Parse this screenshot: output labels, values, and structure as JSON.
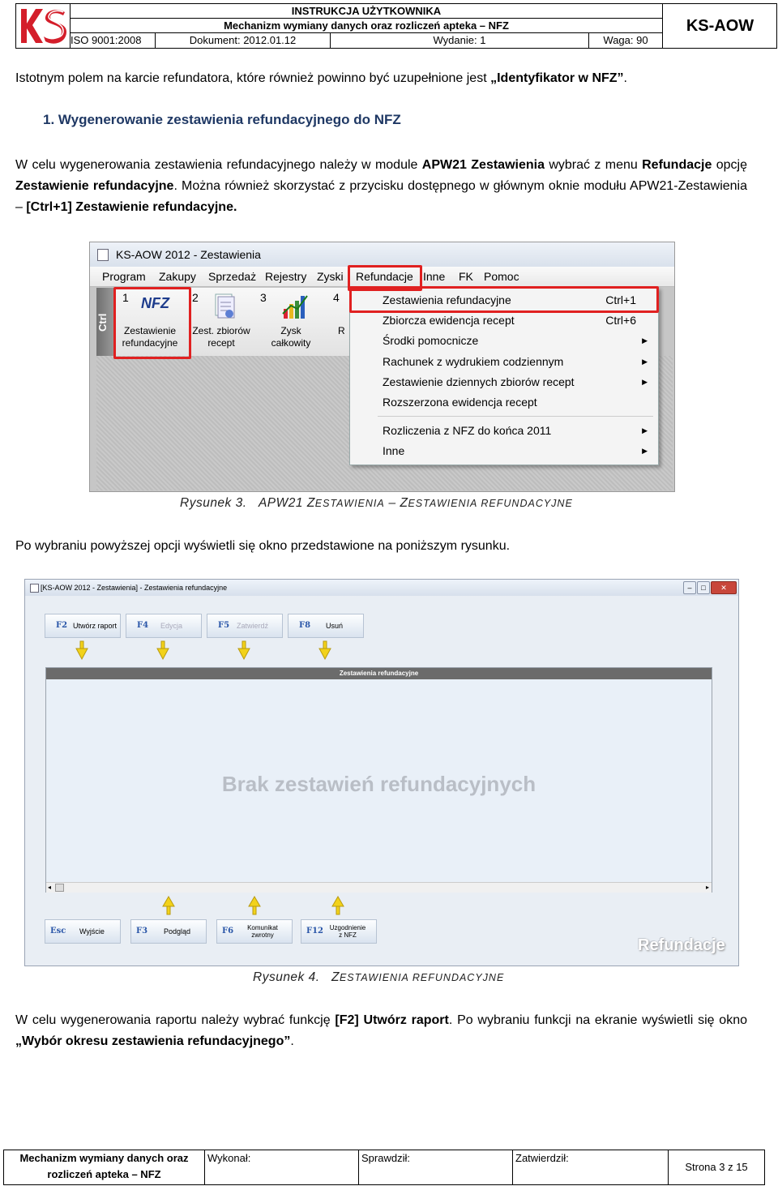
{
  "header": {
    "line1": "INSTRUKCJA UŻYTKOWNIKA",
    "line2": "Mechanizm wymiany danych oraz rozliczeń apteka – NFZ",
    "iso": "ISO 9001:2008",
    "document": "Dokument: 2012.01.12",
    "edition": "Wydanie: 1",
    "weight": "Waga: 90",
    "product": "KS-AOW"
  },
  "body": {
    "p1_a": "Istotnym polem na karcie refundatora, które również powinno być uzupełnione jest ",
    "p1_b": "„Identyfikator w NFZ”",
    "p1_c": ".",
    "heading": "1. Wygenerowanie zestawienia refundacyjnego do NFZ",
    "p2_a": "W celu wygenerowania zestawienia refundacyjnego należy w module ",
    "p2_b": "APW21 Zestawienia",
    "p2_c": " wybrać z menu ",
    "p2_d": "Refundacje",
    "p2_e": " opcję ",
    "p2_f": "Zestawienie refundacyjne",
    "p2_g": ". Można również skorzystać z przycisku dostępnego w głównym oknie modułu APW21-Zestawienia – ",
    "p2_h": "[Ctrl+1] Zestawienie refundacyjne.",
    "cap1_a": "Rysunek 3.",
    "cap1_b": "APW21 Z",
    "cap1_c": "ESTAWIENIA",
    "cap1_d": " – Z",
    "cap1_e": "ESTAWIENIA REFUNDACYJNE",
    "p3": "Po wybraniu powyższej opcji wyświetli się okno przedstawione na poniższym rysunku.",
    "cap2_a": "Rysunek 4.",
    "cap2_b": "Z",
    "cap2_c": "ESTAWIENIA REFUNDACYJNE",
    "p4_a": "W celu wygenerowania raportu należy wybrać funkcję ",
    "p4_b": "[F2] Utwórz raport",
    "p4_c": ". Po wybraniu funkcji na ekranie wyświetli się okno ",
    "p4_d": "„Wybór okresu zestawienia refundacyjnego”",
    "p4_e": "."
  },
  "screenshot1": {
    "title": "KS-AOW 2012 - Zestawienia",
    "menu": [
      "Program",
      "Zakupy",
      "Sprzedaż",
      "Rejestry",
      "Zyski",
      "Refundacje",
      "Inne",
      "FK",
      "Pomoc"
    ],
    "sidebar_label": "Ctrl",
    "toolbar": [
      {
        "num": "1",
        "icon_text": "NFZ",
        "label1": "Zestawienie",
        "label2": "refundacyjne"
      },
      {
        "num": "2",
        "label1": "Zest. zbiorów",
        "label2": "recept"
      },
      {
        "num": "3",
        "label1": "Zysk",
        "label2": "całkowity"
      },
      {
        "num": "4",
        "label1": "R",
        "label2": ""
      }
    ],
    "dropdown": [
      {
        "label": "Zestawienia refundacyjne",
        "shortcut": "Ctrl+1"
      },
      {
        "label": "Zbiorcza ewidencja recept",
        "shortcut": "Ctrl+6"
      },
      {
        "label": "Środki pomocnicze",
        "arrow": "▶"
      },
      {
        "label": "Rachunek z wydrukiem codziennym",
        "arrow": "▶"
      },
      {
        "label": "Zestawienie dziennych zbiorów recept",
        "arrow": "▶"
      },
      {
        "label": "Rozszerzona ewidencja recept"
      },
      {
        "label": "Rozliczenia z NFZ do końca 2011",
        "arrow": "▶"
      },
      {
        "label": "Inne",
        "arrow": "▶"
      }
    ]
  },
  "screenshot2": {
    "title": "[KS-AOW 2012 - Zestawienia] - Zestawienia refundacyjne",
    "top_buttons": [
      {
        "key": "F2",
        "label": "Utwórz raport"
      },
      {
        "key": "F4",
        "label": "Edycja"
      },
      {
        "key": "F5",
        "label": "Zatwierdź"
      },
      {
        "key": "F8",
        "label": "Usuń"
      }
    ],
    "panel_title": "Zestawienia refundacyjne",
    "empty_text": "Brak zestawień refundacyjnych",
    "bottom_buttons": [
      {
        "key": "Esc",
        "label": "Wyjście"
      },
      {
        "key": "F3",
        "label": "Podgląd"
      },
      {
        "key": "F6",
        "label1": "Komunikat",
        "label2": "zwrotny"
      },
      {
        "key": "F12",
        "label1": "Uzgodnienie",
        "label2": "z NFZ"
      }
    ],
    "watermark": "Refundacje"
  },
  "footer": {
    "c1_line1": "Mechanizm wymiany danych oraz",
    "c1_line2": "rozliczeń apteka – NFZ",
    "c2": "Wykonał:",
    "c3": "Sprawdził:",
    "c4": "Zatwierdził:",
    "c5": "Strona 3 z 15"
  },
  "colors": {
    "accent_red": "#e02020",
    "heading_blue": "#1f3864",
    "logo_red": "#d41e2a"
  }
}
